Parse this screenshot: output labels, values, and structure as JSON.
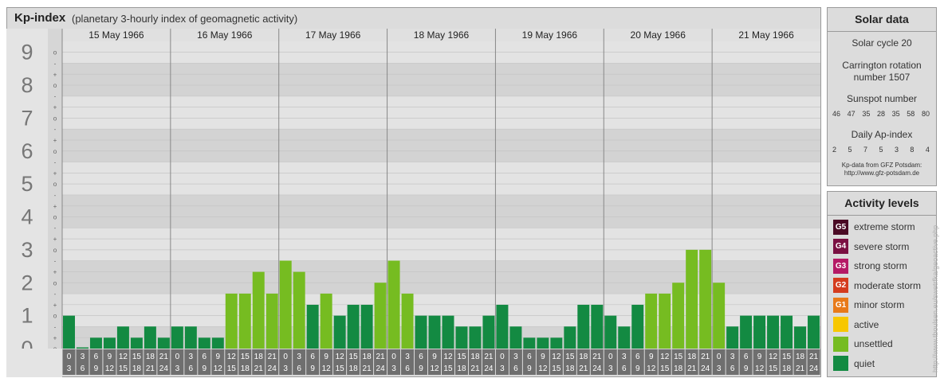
{
  "title": {
    "main": "Kp-index",
    "subtitle": "(planetary 3-hourly index of geomagnetic activity)"
  },
  "chart_data": {
    "type": "bar",
    "y_levels": [
      "0",
      "1",
      "2",
      "3",
      "4",
      "5",
      "6",
      "7",
      "8",
      "9"
    ],
    "minor_labels": [
      "o",
      "+",
      "-"
    ],
    "ylim": [
      0,
      9.33
    ],
    "days": [
      "15 May 1966",
      "16 May 1966",
      "17 May 1966",
      "18 May 1966",
      "19 May 1966",
      "20 May 1966",
      "21 May 1966"
    ],
    "interval_labels": [
      [
        "0",
        "3"
      ],
      [
        "3",
        "6"
      ],
      [
        "6",
        "9"
      ],
      [
        "9",
        "12"
      ],
      [
        "12",
        "15"
      ],
      [
        "15",
        "18"
      ],
      [
        "18",
        "21"
      ],
      [
        "21",
        "24"
      ]
    ],
    "values": [
      [
        1,
        0,
        0.33,
        0.33,
        0.67,
        0.33,
        0.67,
        0.33
      ],
      [
        0.67,
        0.67,
        0.33,
        0.33,
        1.67,
        1.67,
        2.33,
        1.67
      ],
      [
        2.67,
        2.33,
        1.33,
        1.67,
        1,
        1.33,
        1.33,
        2
      ],
      [
        2.67,
        1.67,
        1,
        1,
        1,
        0.67,
        0.67,
        1
      ],
      [
        1.33,
        0.67,
        0.33,
        0.33,
        0.33,
        0.67,
        1.33,
        1.33
      ],
      [
        1,
        0.67,
        1.33,
        1.67,
        1.67,
        2,
        3,
        3
      ],
      [
        2,
        0.67,
        1,
        1,
        1,
        1,
        0.67,
        1
      ]
    ],
    "colors": {
      "quiet": "#138a42",
      "unsettled": "#76bc21",
      "active": "#f7c700"
    }
  },
  "solar": {
    "title": "Solar data",
    "cycle": "Solar cycle 20",
    "carrington_line1": "Carrington rotation",
    "carrington_line2": "number 1507",
    "sunspot_label": "Sunspot number",
    "sunspot_values": [
      "46",
      "47",
      "35",
      "28",
      "35",
      "58",
      "80"
    ],
    "ap_label": "Daily Ap-index",
    "ap_values": [
      "2",
      "5",
      "7",
      "5",
      "3",
      "8",
      "4"
    ],
    "source_line1": "Kp-data from GFZ Potsdam:",
    "source_line2": "http://www.gfz-potsdam.de"
  },
  "activity": {
    "title": "Activity levels",
    "levels": [
      {
        "code": "G5",
        "label": "extreme storm",
        "color": "#4a0a24"
      },
      {
        "code": "G4",
        "label": "severe storm",
        "color": "#7a1042"
      },
      {
        "code": "G3",
        "label": "strong storm",
        "color": "#b51a66"
      },
      {
        "code": "G2",
        "label": "moderate storm",
        "color": "#d43c1e"
      },
      {
        "code": "G1",
        "label": "minor storm",
        "color": "#e87a1a"
      },
      {
        "code": "",
        "label": "active",
        "color": "#f7c700"
      },
      {
        "code": "",
        "label": "unsettled",
        "color": "#76bc21"
      },
      {
        "code": "",
        "label": "quiet",
        "color": "#138a42"
      }
    ]
  },
  "watermark": "http://www.tboulsen.eu/swetrfka/geoactive.php"
}
